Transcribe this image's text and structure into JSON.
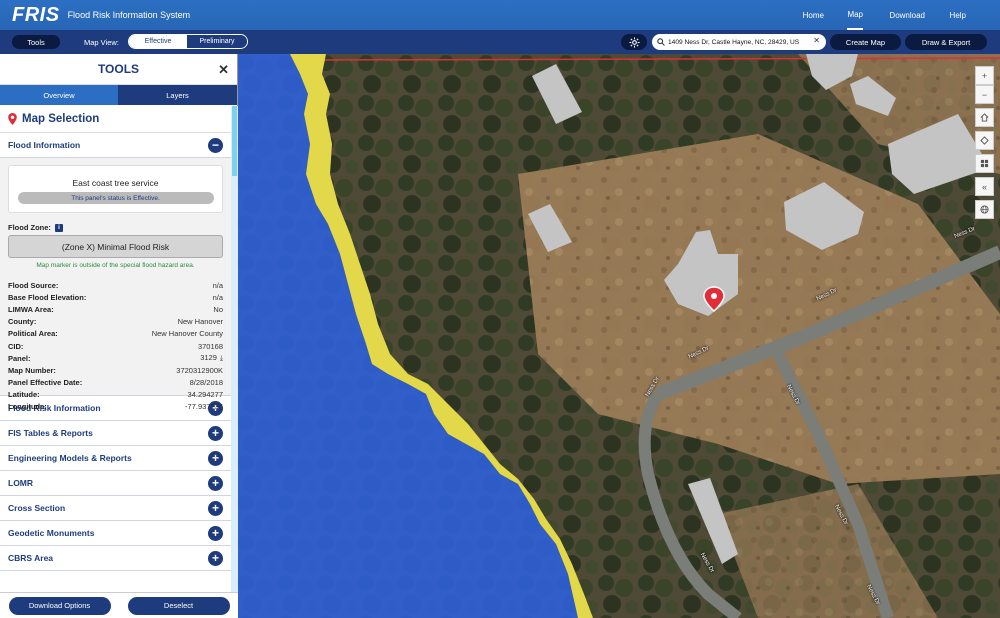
{
  "header": {
    "logo": "FRIS",
    "subtitle": "Flood Risk Information System",
    "nav": {
      "home": "Home",
      "map": "Map",
      "download": "Download",
      "help": "Help"
    }
  },
  "toolbar": {
    "tools_label": "Tools",
    "map_view_label": "Map View:",
    "map_view_options": {
      "effective": "Effective",
      "preliminary": "Preliminary"
    },
    "search_value": "1409 Ness Dr, Castle Hayne, NC, 28429, US",
    "create_map_label": "Create Map",
    "draw_export_label": "Draw & Export"
  },
  "sidebar": {
    "title": "TOOLS",
    "tabs": {
      "overview": "Overview",
      "layers": "Layers"
    },
    "section_title": "Map Selection",
    "flood_info": {
      "header": "Flood Information",
      "card_title": "East coast tree service",
      "status": "This panel's status is Effective.",
      "flood_zone_label": "Flood Zone:",
      "flood_zone_value": "(Zone X) Minimal Flood Risk",
      "note": "Map marker is outside of the special flood hazard area.",
      "properties": [
        {
          "label": "Flood Source:",
          "value": "n/a"
        },
        {
          "label": "Base Flood Elevation:",
          "value": "n/a"
        },
        {
          "label": "LIMWA Area:",
          "value": "No"
        },
        {
          "label": "County:",
          "value": "New Hanover"
        },
        {
          "label": "Political Area:",
          "value": "New Hanover County"
        },
        {
          "label": "CID:",
          "value": "370168"
        },
        {
          "label": "Panel:",
          "value": "3129"
        },
        {
          "label": "Map Number:",
          "value": "3720312900K"
        },
        {
          "label": "Panel Effective Date:",
          "value": "8/28/2018"
        },
        {
          "label": "Latitude:",
          "value": "34.294277"
        },
        {
          "label": "Longitude:",
          "value": "-77.937736"
        }
      ]
    },
    "sections": [
      "Flood Risk Information",
      "FIS Tables & Reports",
      "Engineering Models & Reports",
      "LOMR",
      "Cross Section",
      "Geodetic Monuments",
      "CBRS Area"
    ],
    "footer": {
      "download": "Download Options",
      "deselect": "Deselect"
    }
  },
  "map": {
    "road_labels": [
      "Ness Dr",
      "Ness Dr",
      "Ness Dr",
      "Ness Dr",
      "Ness Dr",
      "Ness Dr",
      "Ness Dr",
      "Ness Dr"
    ],
    "controls": [
      "zoom-in",
      "zoom-out",
      "home",
      "locate",
      "basemap",
      "collapse",
      "globe"
    ],
    "colors": {
      "floodway": "#2f5fd6",
      "zone_ae_shade": "#e3d84a",
      "marker": "#e32b3a"
    }
  }
}
